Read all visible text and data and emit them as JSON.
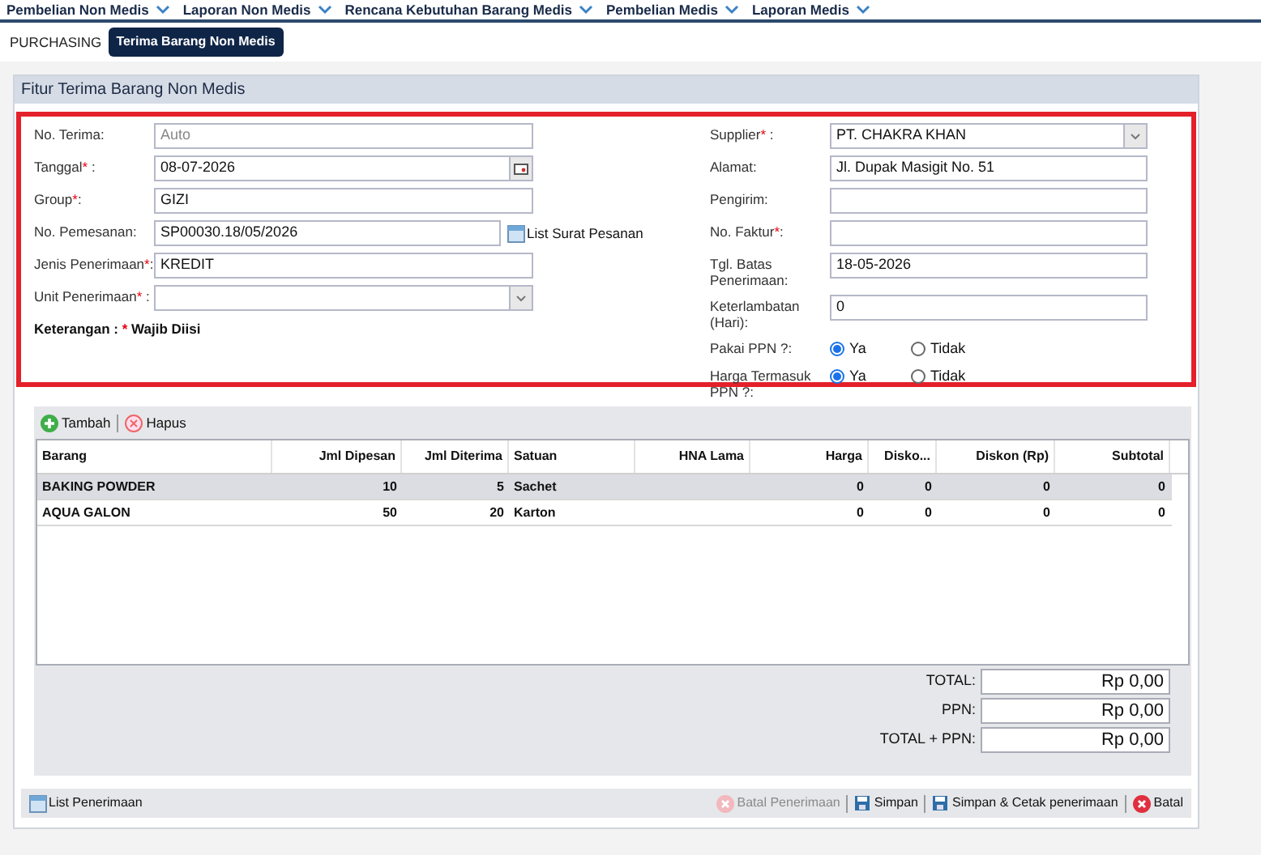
{
  "menu": [
    {
      "label": "Pembelian Non Medis"
    },
    {
      "label": "Laporan Non Medis"
    },
    {
      "label": "Rencana Kebutuhan Barang Medis"
    },
    {
      "label": "Pembelian Medis"
    },
    {
      "label": "Laporan Medis"
    }
  ],
  "breadcrumb": {
    "root": "PURCHASING",
    "current": "Terima Barang Non Medis"
  },
  "panel_title": "Fitur Terima Barang Non Medis",
  "left_fields": [
    {
      "kind": "text",
      "label": "No. Terima:",
      "placeholder": "Auto"
    },
    {
      "kind": "date",
      "label": "Tanggal",
      "mark": "*",
      "suffix": " :",
      "value": "08-07-2026"
    },
    {
      "kind": "text",
      "label": "Group",
      "mark": "*",
      "suffix": ":",
      "value": "GIZI"
    },
    {
      "kind": "link",
      "label": "No. Pemesanan:",
      "value": "SP00030.18/05/2026",
      "link": "List Surat Pesanan"
    },
    {
      "kind": "text",
      "label": "Jenis Penerimaan",
      "mark": "*",
      "suffix": ":",
      "value": "KREDIT"
    },
    {
      "kind": "select",
      "label": "Unit Penerimaan",
      "mark": "*",
      "suffix": " :"
    }
  ],
  "note": {
    "label": "Keterangan :",
    "mark": "*",
    "text": "Wajib Diisi"
  },
  "right_fields": [
    {
      "kind": "select",
      "label": "Supplier",
      "mark": "*",
      "suffix": " :",
      "value": "PT. CHAKRA KHAN"
    },
    {
      "kind": "text",
      "label": "Alamat:",
      "value": "Jl. Dupak Masigit No. 51"
    },
    {
      "kind": "text",
      "label": "Pengirim:"
    },
    {
      "kind": "text",
      "label": "No. Faktur",
      "mark": "*",
      "suffix": ":"
    },
    {
      "kind": "text",
      "label": "Tgl. Batas Penerimaan:",
      "value": "18-05-2026"
    },
    {
      "kind": "text",
      "label": "Keterlambatan (Hari):",
      "value": "0"
    },
    {
      "kind": "radio",
      "label": "Pakai PPN ?:",
      "options": [
        {
          "label": "Ya",
          "selected": true
        },
        {
          "label": "Tidak",
          "selected": false
        }
      ]
    },
    {
      "kind": "radio",
      "label": "Harga Termasuk PPN ?:",
      "options": [
        {
          "label": "Ya",
          "selected": true
        },
        {
          "label": "Tidak",
          "selected": false
        }
      ]
    }
  ],
  "grid_toolbar": [
    {
      "kind": "add",
      "label": "Tambah"
    },
    {
      "kind": "delete",
      "label": "Hapus"
    }
  ],
  "table": {
    "columns": [
      "Barang",
      "Jml Dipesan",
      "Jml Diterima",
      "Satuan",
      "HNA Lama",
      "Harga",
      "Disko...",
      "Diskon (Rp)",
      "Subtotal"
    ],
    "rows": [
      {
        "selected": true,
        "cells": [
          "BAKING POWDER",
          "10",
          "5",
          "Sachet",
          null,
          "0",
          "0",
          "0",
          "0"
        ]
      },
      {
        "selected": false,
        "cells": [
          "AQUA GALON",
          "50",
          "20",
          "Karton",
          null,
          "0",
          "0",
          "0",
          "0"
        ]
      }
    ]
  },
  "totals": [
    {
      "label": "TOTAL:",
      "value": "Rp 0,00"
    },
    {
      "label": "PPN:",
      "value": "Rp 0,00"
    },
    {
      "label": "TOTAL + PPN:",
      "value": "Rp 0,00"
    }
  ],
  "footer": {
    "list_button": "List Penerimaan",
    "actions": [
      {
        "kind": "cancel",
        "label": "Batal Penerimaan",
        "disabled": true
      },
      {
        "kind": "save",
        "label": "Simpan",
        "disabled": false
      },
      {
        "kind": "save",
        "label": "Simpan & Cetak penerimaan",
        "disabled": false
      },
      {
        "kind": "cancel",
        "label": "Batal",
        "disabled": false
      }
    ]
  }
}
